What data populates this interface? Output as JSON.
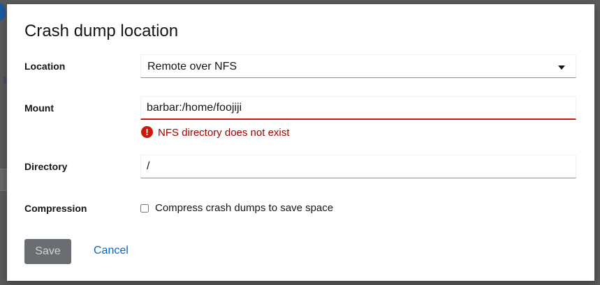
{
  "dialog": {
    "title": "Crash dump location"
  },
  "form": {
    "location": {
      "label": "Location",
      "selected": "Remote over NFS"
    },
    "mount": {
      "label": "Mount",
      "value": "barbar:/home/foojiji",
      "error": "NFS directory does not exist"
    },
    "directory": {
      "label": "Directory",
      "value": "/"
    },
    "compression": {
      "label": "Compression",
      "checkbox_label": "Compress crash dumps to save space",
      "checked": false
    }
  },
  "actions": {
    "save_label": "Save",
    "cancel_label": "Cancel"
  },
  "colors": {
    "error": "#c9190b",
    "link": "#0066cc",
    "disabled_button": "#6a6e73"
  },
  "icons": {
    "error": "exclamation-circle-icon",
    "dropdown": "caret-down-icon"
  }
}
